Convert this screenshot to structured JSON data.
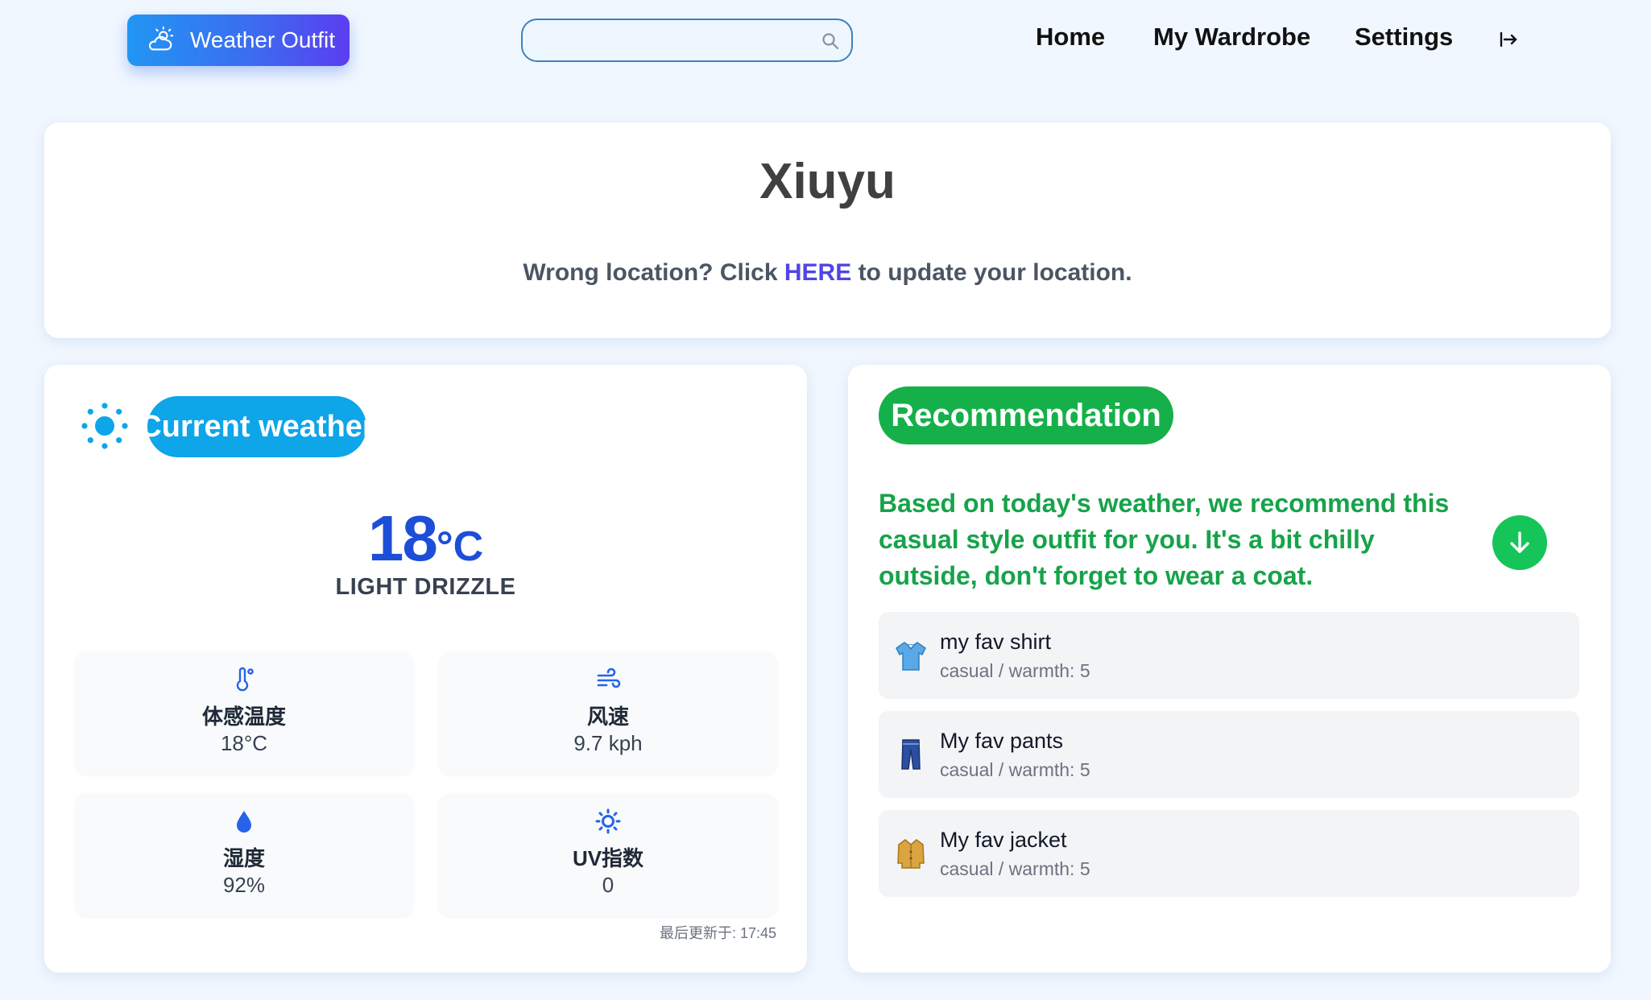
{
  "nav": {
    "brand": "Weather Outfit",
    "search_placeholder": "",
    "links": [
      "Home",
      "My Wardrobe",
      "Settings"
    ]
  },
  "location": {
    "name": "Xiuyu",
    "msg_prefix": "Wrong location? Click ",
    "msg_link": "HERE",
    "msg_suffix": " to update your location."
  },
  "weather": {
    "title": "Current weather",
    "temp": "18",
    "unit": "°C",
    "condition": "LIGHT DRIZZLE",
    "stats": [
      {
        "label": "体感温度",
        "value": "18°C",
        "icon": "thermometer-icon"
      },
      {
        "label": "风速",
        "value": "9.7 kph",
        "icon": "wind-icon"
      },
      {
        "label": "湿度",
        "value": "92%",
        "icon": "humidity-icon"
      },
      {
        "label": "UV指数",
        "value": "0",
        "icon": "uv-icon"
      }
    ],
    "updated": "最后更新于: 17:45"
  },
  "recommendation": {
    "title": "Recommendation",
    "text": "Based on today's weather, we recommend this casual style outfit for you. It's a bit chilly outside, don't forget to wear a coat.",
    "items": [
      {
        "name": "my fav shirt",
        "meta": "casual / warmth: 5",
        "icon": "shirt-icon"
      },
      {
        "name": "My fav pants",
        "meta": "casual / warmth: 5",
        "icon": "pants-icon"
      },
      {
        "name": "My fav jacket",
        "meta": "casual / warmth: 5",
        "icon": "coat-icon"
      }
    ]
  },
  "colors": {
    "brand_gradient_start": "#2196f3",
    "brand_gradient_end": "#5b3ef0",
    "weather_pill": "#0ea5e9",
    "recommend_green": "#16a34a",
    "temp_blue": "#1d4ed8",
    "link_purple": "#4f46e5"
  }
}
